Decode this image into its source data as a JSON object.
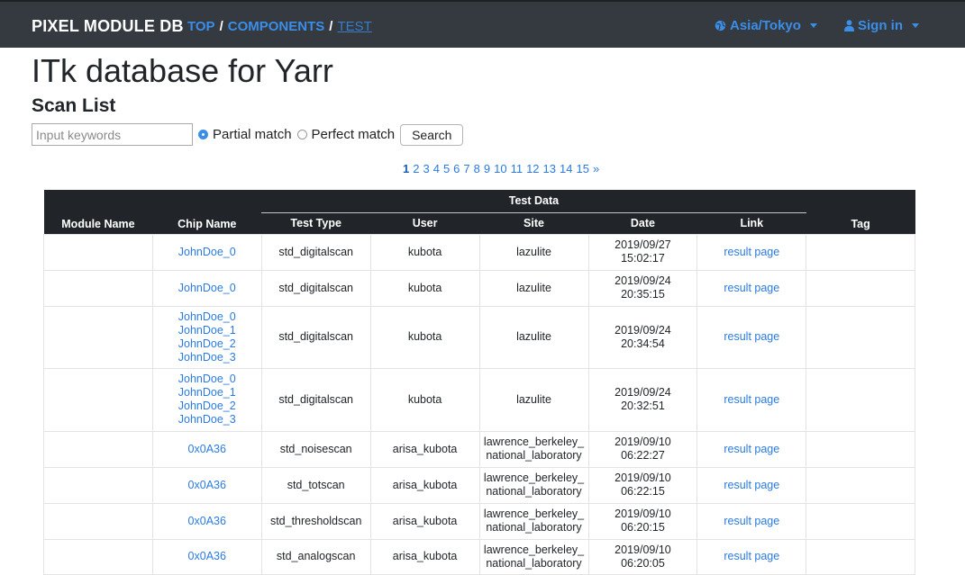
{
  "navbar": {
    "brand": "PIXEL MODULE DB",
    "breadcrumb": [
      "TOP",
      "COMPONENTS",
      "TEST"
    ],
    "separator": "/",
    "timezone": "Asia/Tokyo",
    "signin": "Sign in"
  },
  "page": {
    "title": "ITk database for Yarr",
    "section": "Scan List"
  },
  "search": {
    "placeholder": "Input keywords",
    "value": "",
    "partial_label": "Partial match",
    "perfect_label": "Perfect match",
    "selected": "partial",
    "button": "Search"
  },
  "pagination": {
    "pages": [
      "1",
      "2",
      "3",
      "4",
      "5",
      "6",
      "7",
      "8",
      "9",
      "10",
      "11",
      "12",
      "13",
      "14",
      "15"
    ],
    "current": "1",
    "next": "»"
  },
  "table": {
    "headers": {
      "module": "Module Name",
      "chip": "Chip Name",
      "group": "Test Data",
      "type": "Test Type",
      "user": "User",
      "site": "Site",
      "date": "Date",
      "link": "Link",
      "tag": "Tag"
    },
    "rows": [
      {
        "module": "",
        "chips": [
          "JohnDoe_0"
        ],
        "type": "std_digitalscan",
        "user": "kubota",
        "site": [
          "lazulite"
        ],
        "date": [
          "2019/09/27",
          "15:02:17"
        ],
        "link": "result page",
        "tag": ""
      },
      {
        "module": "",
        "chips": [
          "JohnDoe_0"
        ],
        "type": "std_digitalscan",
        "user": "kubota",
        "site": [
          "lazulite"
        ],
        "date": [
          "2019/09/24",
          "20:35:15"
        ],
        "link": "result page",
        "tag": ""
      },
      {
        "module": "",
        "chips": [
          "JohnDoe_0",
          "JohnDoe_1",
          "JohnDoe_2",
          "JohnDoe_3"
        ],
        "type": "std_digitalscan",
        "user": "kubota",
        "site": [
          "lazulite"
        ],
        "date": [
          "2019/09/24",
          "20:34:54"
        ],
        "link": "result page",
        "tag": ""
      },
      {
        "module": "",
        "chips": [
          "JohnDoe_0",
          "JohnDoe_1",
          "JohnDoe_2",
          "JohnDoe_3"
        ],
        "type": "std_digitalscan",
        "user": "kubota",
        "site": [
          "lazulite"
        ],
        "date": [
          "2019/09/24",
          "20:32:51"
        ],
        "link": "result page",
        "tag": ""
      },
      {
        "module": "",
        "chips": [
          "0x0A36"
        ],
        "type": "std_noisescan",
        "user": "arisa_kubota",
        "site": [
          "lawrence_berkeley_",
          "national_laboratory"
        ],
        "date": [
          "2019/09/10",
          "06:22:27"
        ],
        "link": "result page",
        "tag": ""
      },
      {
        "module": "",
        "chips": [
          "0x0A36"
        ],
        "type": "std_totscan",
        "user": "arisa_kubota",
        "site": [
          "lawrence_berkeley_",
          "national_laboratory"
        ],
        "date": [
          "2019/09/10",
          "06:22:15"
        ],
        "link": "result page",
        "tag": ""
      },
      {
        "module": "",
        "chips": [
          "0x0A36"
        ],
        "type": "std_thresholdscan",
        "user": "arisa_kubota",
        "site": [
          "lawrence_berkeley_",
          "national_laboratory"
        ],
        "date": [
          "2019/09/10",
          "06:20:15"
        ],
        "link": "result page",
        "tag": ""
      },
      {
        "module": "",
        "chips": [
          "0x0A36"
        ],
        "type": "std_analogscan",
        "user": "arisa_kubota",
        "site": [
          "lawrence_berkeley_",
          "national_laboratory"
        ],
        "date": [
          "2019/09/10",
          "06:20:05"
        ],
        "link": "result page",
        "tag": ""
      }
    ]
  },
  "colors": {
    "navbar_bg": "#343a40",
    "link": "#2a7ae2",
    "table_header_bg": "#212529"
  }
}
